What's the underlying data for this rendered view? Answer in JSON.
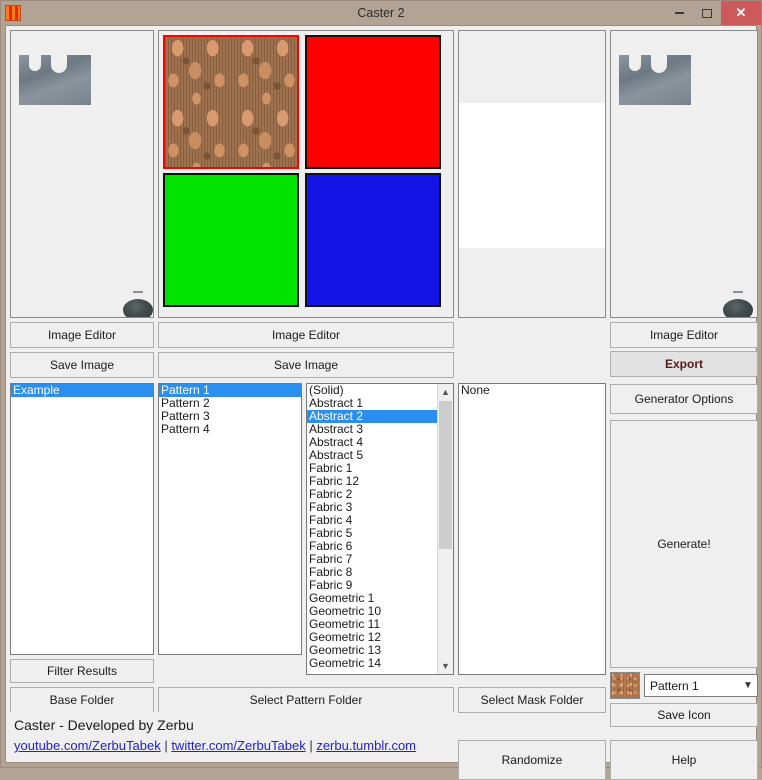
{
  "window": {
    "title": "Caster 2",
    "app_icon": "checkered-pattern-icon",
    "minimize_label": "–",
    "maximize_label": "□",
    "close_label": "✕",
    "accent_close": "#cc5a5a",
    "titlebar_color": "#b3a394",
    "client_color": "#efefef",
    "selection_color": "#2a8fef"
  },
  "left_preview": {
    "name": "base-preview",
    "buttons": [
      {
        "label": "Image Editor",
        "name": "left-image-editor-button"
      },
      {
        "label": "Save Image",
        "name": "left-save-image-button"
      }
    ],
    "list": {
      "items": [
        "Example"
      ],
      "selected_index": 0
    },
    "filter_button": "Filter Results",
    "folder_button": "Base Folder"
  },
  "pattern_preview": {
    "name": "pattern-preview",
    "swatches": [
      {
        "name": "swatch-pattern",
        "kind": "damask",
        "selected": true
      },
      {
        "name": "swatch-red",
        "kind": "solid",
        "color": "#ff0000",
        "selected": false
      },
      {
        "name": "swatch-green",
        "kind": "solid",
        "color": "#00e400",
        "selected": false
      },
      {
        "name": "swatch-blue",
        "kind": "solid",
        "color": "#1414e6",
        "selected": false
      }
    ],
    "buttons": [
      {
        "label": "Image Editor",
        "name": "pattern-image-editor-button"
      },
      {
        "label": "Save Image",
        "name": "pattern-save-image-button"
      }
    ],
    "pattern_list": {
      "items": [
        "Pattern 1",
        "Pattern 2",
        "Pattern 3",
        "Pattern 4"
      ],
      "selected_index": 0
    },
    "texture_list": {
      "items": [
        "(Solid)",
        "Abstract 1",
        "Abstract 2",
        "Abstract 3",
        "Abstract 4",
        "Abstract 5",
        "Fabric 1",
        "Fabric 12",
        "Fabric 2",
        "Fabric 3",
        "Fabric 4",
        "Fabric 5",
        "Fabric 6",
        "Fabric 7",
        "Fabric 8",
        "Fabric 9",
        "Geometric 1",
        "Geometric 10",
        "Geometric 11",
        "Geometric 12",
        "Geometric 13",
        "Geometric 14"
      ],
      "selected_index": 2,
      "scroll_up_icon": "chevron-up-icon",
      "scroll_down_icon": "chevron-down-icon"
    },
    "folder_button": "Select Pattern Folder"
  },
  "mask_panel": {
    "name": "mask-preview",
    "list": {
      "items": [
        "None"
      ],
      "selected_index": -1
    },
    "folder_button": "Select Mask Folder",
    "randomize_button": "Randomize"
  },
  "right_panel": {
    "name": "output-preview",
    "buttons": [
      {
        "label": "Image Editor",
        "name": "output-image-editor-button",
        "style": "normal"
      },
      {
        "label": "Export",
        "name": "export-button",
        "style": "bold-hover"
      },
      {
        "label": "Generator Options",
        "name": "generator-options-button",
        "style": "normal"
      }
    ],
    "generate_button": "Generate!",
    "icon_combo": {
      "value": "Pattern 1",
      "arrow_icon": "chevron-down-icon",
      "thumb": "pattern-thumbnail"
    },
    "save_icon_button": "Save Icon",
    "help_button": "Help"
  },
  "footer": {
    "credit": "Caster - Developed by Zerbu",
    "links": [
      {
        "label": "youtube.com/ZerbuTabek",
        "name": "youtube-link"
      },
      {
        "label": "twitter.com/ZerbuTabek",
        "name": "twitter-link"
      },
      {
        "label": "zerbu.tumblr.com",
        "name": "tumblr-link"
      }
    ],
    "separator": "|"
  }
}
